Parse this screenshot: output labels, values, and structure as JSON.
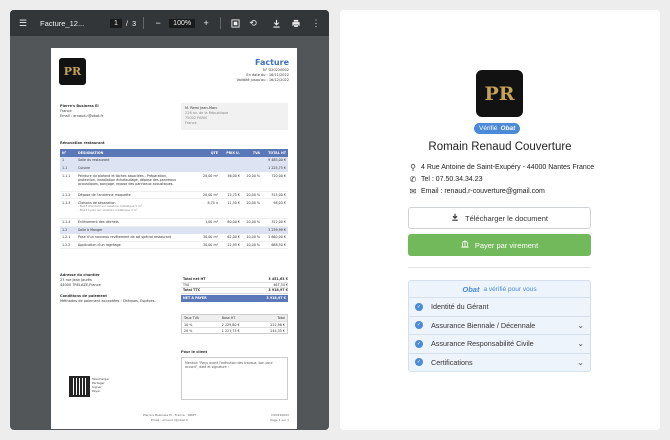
{
  "viewer": {
    "file_name": "Facture_12...",
    "page_current": "1",
    "page_sep": "/",
    "page_total": "3",
    "zoom": "100%",
    "icons": [
      "menu-icon",
      "zoom-out-icon",
      "zoom-in-icon",
      "fit-page-icon",
      "rotate-icon",
      "download-icon",
      "print-icon",
      "more-icon"
    ]
  },
  "doc": {
    "title": "Facture",
    "number": "N° D20220002",
    "date": "En date du : 16/11/2022",
    "validity": "Validité jusqu'au : 16/12/2022",
    "company": [
      "Pierre's Business EI",
      "France",
      "Email : arnaud.r@obat.fr"
    ],
    "client": [
      "M. Remi Jean-Marc",
      "226 av. de la République",
      "75002 PARIS",
      "France"
    ],
    "work_title": "Rénovation restaurant",
    "headers": [
      "N°",
      "DÉSIGNATION",
      "QTÉ",
      "PRIX U.",
      "TVA",
      "TOTAL HT"
    ],
    "rows": [
      {
        "type": "s",
        "n": "1",
        "d": "Salle du restaurant",
        "q": "",
        "p": "",
        "v": "",
        "t": "9 485,00 €"
      },
      {
        "type": "s",
        "n": "1.1",
        "d": "Cuisine",
        "q": "",
        "p": "",
        "v": "",
        "t": "1 225,75 €"
      },
      {
        "type": "m",
        "n": "1.1.1",
        "d": "Peinture du plafond et tâches associées - Préparation,",
        "d2": "protection, installation échafaudage, dépose des panneaux",
        "d3": "acoustiques, ponçage, repose des panneaux acoustiques.",
        "q": "20,00 m²",
        "p": "36,00 €",
        "v": "20,00 %",
        "t": "720,00 €"
      },
      {
        "type": "l",
        "n": "1.1.2",
        "d": "Dépose de l'ancienne moquette",
        "q": "20,00 m²",
        "p": "15,75 €",
        "v": "20,00 %",
        "t": "315,00 €"
      },
      {
        "type": "m",
        "n": "1.1.3",
        "d": "Cloisons de séparation",
        "d2": "- BA13 standard sur ossature métallique 5 m²",
        "d3": "- BA13 hydro sur ossature métallique 3 m²",
        "q": "8,75 u",
        "p": "11,50 €",
        "v": "20,00 %",
        "t": "98,03 €"
      },
      {
        "type": "l",
        "n": "1.1.4",
        "d": "Enlèvement des déchets",
        "q": "1,00 m³",
        "p": "80,00 €",
        "v": "20,00 %",
        "t": "322,00 €"
      },
      {
        "type": "s",
        "n": "1.2",
        "d": "Salle à Manger",
        "q": "",
        "p": "",
        "v": "",
        "t": "3 239,99 €"
      },
      {
        "type": "l",
        "n": "1.2.1",
        "d": "Pose d'un nouveau revêtement de sol spécial restaurant",
        "q": "30,00 m²",
        "p": "62,00 €",
        "v": "10,00 %",
        "t": "1 860,00 €"
      },
      {
        "type": "l",
        "n": "1.2.2",
        "d": "Application d'un ragréage",
        "q": "30,00 m²",
        "p": "22,95 €",
        "v": "10,00 %",
        "t": "688,50 €"
      }
    ],
    "site_title": "Adresse du chantier",
    "site": [
      "23 rue Jean Jaurès",
      "44000 TRELAZE,France"
    ],
    "payment_title": "Conditions de paiement",
    "payment": "Méthodes de paiement acceptées : Chèques, Espèces.",
    "totals": [
      [
        "Total net HT",
        "3 451,63 €"
      ],
      [
        "TVA",
        "467,54 €"
      ],
      [
        "Total TTC",
        "3 918,97 €"
      ]
    ],
    "to_pay": [
      "NET À PAYER",
      "3 918,97 €"
    ],
    "vat_head": [
      "Taux TVA",
      "Base HT",
      "Total"
    ],
    "vat_rows": [
      [
        "10 %",
        "2 229,80 €",
        "222,98 €"
      ],
      [
        "20 %",
        "1 221,73 €",
        "244,35 €"
      ]
    ],
    "client_box_title": "Pour le client",
    "client_box_text": "Mention \"Reçu avant l'exécution des travaux, bon pour accord\", daté et signature :",
    "qr_text": [
      "Télécharger",
      "Partager",
      "Signer",
      "Payer"
    ],
    "footer": [
      "Pierre's Business EI · France · SIRET :",
      "Email : arnaud.r@obat.fr"
    ],
    "footer_right": [
      "D20220002",
      "Page 1 sur 1"
    ]
  },
  "profile": {
    "name": "Romain Renaud Couverture",
    "verified_label": "Vérifié",
    "verified_brand": "Obat",
    "address": "4 Rue Antoine de Saint-Exupéry - 44000 Nantes France",
    "phone": "Tel : 07.50.34.34.23",
    "email": "Email : renaud.r-couverture@gmail.com",
    "download_label": "Télécharger le document",
    "pay_label": "Payer par virement",
    "verify_brand": "Obat",
    "verify_text": "a vérifié pour vous",
    "items": [
      {
        "label": "Identité du Gérant",
        "expand": false
      },
      {
        "label": "Assurance Biennale / Décennale",
        "expand": true
      },
      {
        "label": "Assurance Responsabilité Civile",
        "expand": true
      },
      {
        "label": "Certifications",
        "expand": true
      }
    ]
  },
  "colors": {
    "viewer_bg": "#525659",
    "toolbar_bg": "#323639",
    "accent_blue": "#3f6fc1",
    "pay_green": "#72b95b",
    "header_blue": "#5a77b7"
  }
}
